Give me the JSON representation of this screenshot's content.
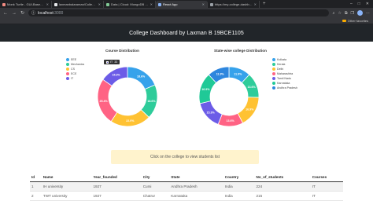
{
  "browser": {
    "tabs": [
      {
        "title": "Monk Turtle - GUI-Based Rand",
        "fav": "#f28b82",
        "active": false
      },
      {
        "title": "laxmanbalaraman/College-Dash",
        "fav": "#e8eaed",
        "active": false
      },
      {
        "title": "Data | Cloud: MongoDB Cloud",
        "fav": "#81c995",
        "active": false
      },
      {
        "title": "React App",
        "fav": "#8ab4f8",
        "active": true
      },
      {
        "title": "https://my-college-dashboard",
        "fav": "#9aa0a6",
        "active": false
      }
    ],
    "url_host": "localhost",
    "url_port": ":3000",
    "bookmarks_label": "Other favorites"
  },
  "header": {
    "title": "College Dashboard by Laxman B 19BCE1105"
  },
  "course_chart": {
    "title": "Course Distribution",
    "tooltip_label": "IT",
    "tooltip_value": "33"
  },
  "state_chart": {
    "title": "State-wise college Distribution"
  },
  "notice": "Click on the college to view students list",
  "table": {
    "headers": [
      "Id",
      "Name",
      "Year_founded",
      "City",
      "State",
      "Country",
      "No_of_students",
      "Courses"
    ],
    "rows": [
      [
        "1",
        "IH university",
        "1927",
        "Cumi",
        "Andhra Pradesh",
        "India",
        "224",
        "IT"
      ],
      [
        "2",
        "TWT university",
        "1927",
        "Chatrur",
        "Karnataka",
        "India",
        "215",
        "IT"
      ]
    ]
  },
  "chart_data": [
    {
      "type": "pie",
      "title": "Course Distribution",
      "labels": [
        "EEE",
        "Mechanics",
        "CS",
        "ECE",
        "IT"
      ],
      "values": [
        18.6,
        18.6,
        22.0,
        25.4,
        15.3
      ],
      "value_labels": [
        "18.6%",
        "18.6%",
        "22.0%",
        "25.4%",
        "15.3%"
      ],
      "colors": [
        "#36a2eb",
        "#2ecc9a",
        "#ffc233",
        "#ff6384",
        "#6c5ce7"
      ],
      "legend": "right"
    },
    {
      "type": "pie",
      "title": "State-wise college Distribution",
      "labels": [
        "Kolkata",
        "Kerala",
        "Delhi",
        "Maharashtra",
        "Tamil Nadu",
        "Karnataka",
        "Andhra Pradesh"
      ],
      "values": [
        11.9,
        13.6,
        16.9,
        13.6,
        15.3,
        16.9,
        11.9
      ],
      "value_labels": [
        "11.9%",
        "13.6%",
        "16.9%",
        "13.6%",
        "15.3%",
        "16.9%",
        "11.9%"
      ],
      "colors": [
        "#36a2eb",
        "#2ecc9a",
        "#ffc233",
        "#ff6384",
        "#6c5ce7",
        "#20c997",
        "#2e86de"
      ],
      "legend": "right"
    }
  ]
}
